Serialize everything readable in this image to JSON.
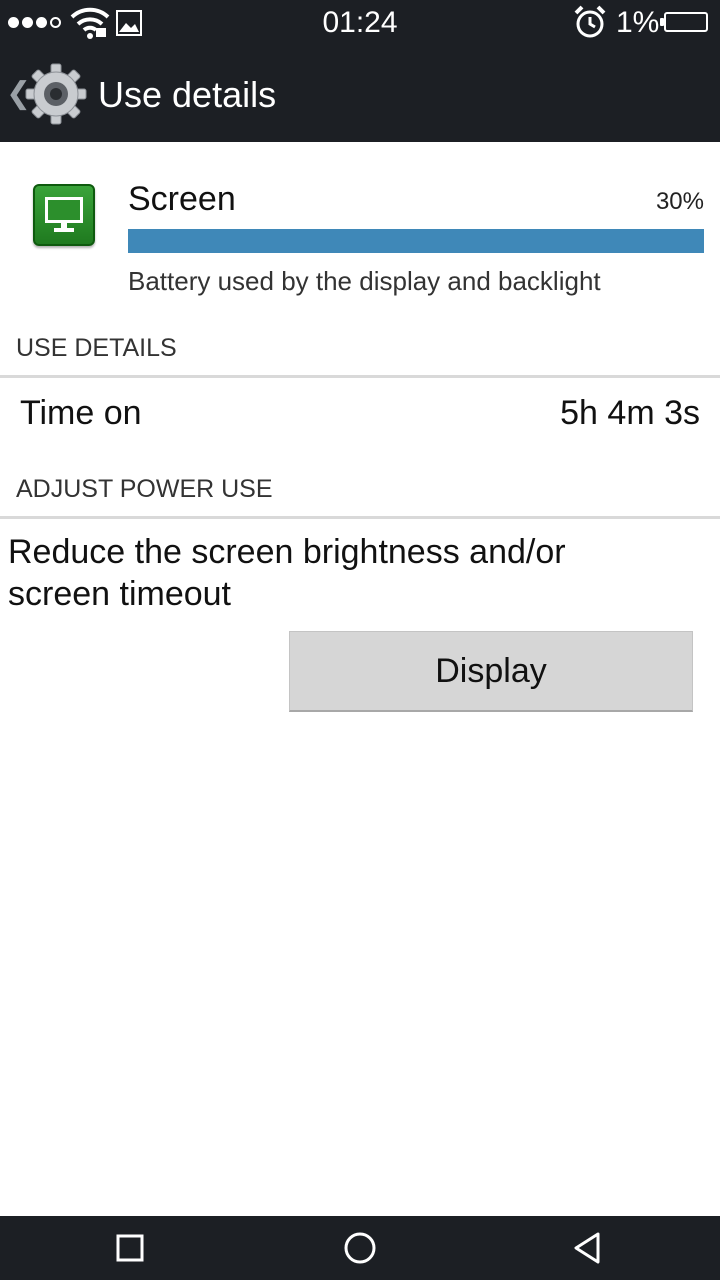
{
  "status_bar": {
    "time": "01:24",
    "battery_percent": "1%",
    "signal_strength": 3,
    "icons": [
      "signal-icon",
      "wifi-icon",
      "gallery-icon",
      "alarm-icon",
      "battery-icon"
    ]
  },
  "action_bar": {
    "title": "Use details",
    "icons": [
      "back-icon",
      "gear-icon"
    ]
  },
  "entry": {
    "title": "Screen",
    "percent": "30%",
    "percent_value": 30,
    "description": "Battery used by the display and backlight",
    "icon": "monitor-icon",
    "bar_color": "#3f88b8",
    "icon_color": "#2c8f2c"
  },
  "use_details": {
    "header": "USE DETAILS",
    "row_label": "Time on",
    "row_value": "5h 4m 3s"
  },
  "adjust_power": {
    "header": "ADJUST POWER USE",
    "tip": "Reduce the screen brightness and/or screen timeout",
    "button_label": "Display"
  },
  "nav_bar": {
    "icons": [
      "recents-icon",
      "home-icon",
      "back-icon"
    ]
  }
}
